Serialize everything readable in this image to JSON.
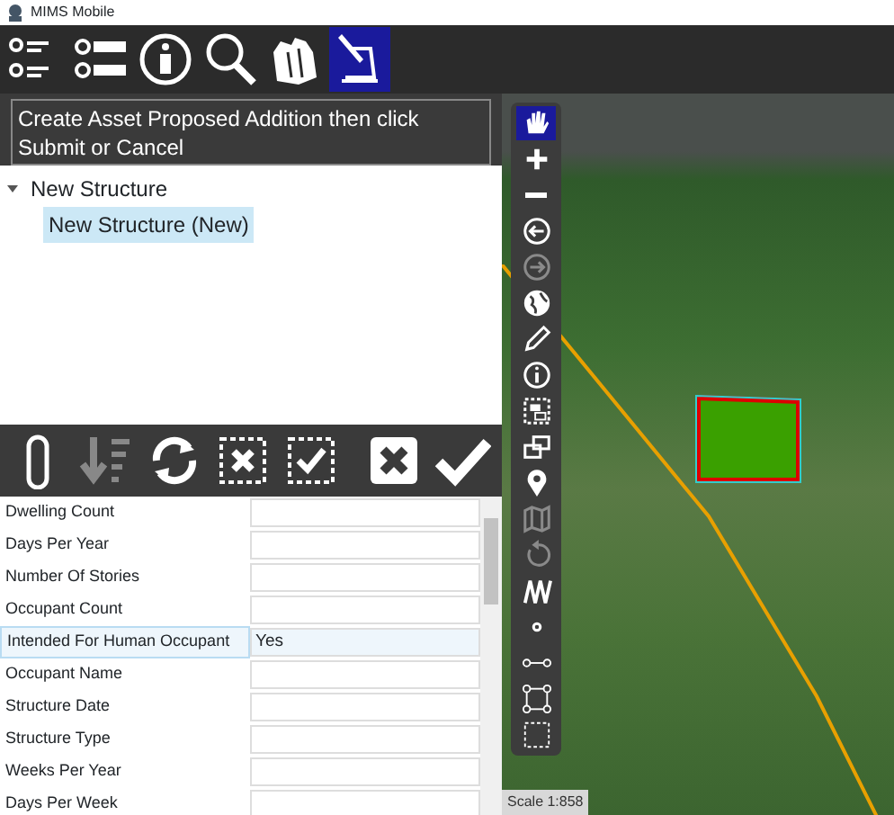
{
  "window": {
    "title": "MIMS Mobile"
  },
  "main_toolbar": [
    {
      "selected": false
    },
    {
      "selected": false
    },
    {
      "selected": false
    },
    {
      "selected": false
    },
    {
      "selected": false
    },
    {
      "selected": true
    }
  ],
  "message": "Create Asset Proposed Addition then click Submit or Cancel",
  "tree": [
    {
      "label": "New Structure",
      "expanded": true,
      "selected": false,
      "children": [
        {
          "label": "New Structure (New)",
          "selected": true
        }
      ]
    }
  ],
  "action_toolbar": [
    {
      "disabled": false
    },
    {
      "disabled": true
    },
    {
      "disabled": false
    },
    {
      "disabled": false
    },
    {
      "disabled": false
    },
    {
      "disabled": false
    },
    {
      "disabled": false
    }
  ],
  "properties": [
    {
      "name": "Dwelling Count",
      "selected": false
    },
    {
      "name": "Days Per Year",
      "selected": false
    },
    {
      "name": "Number Of Stories",
      "selected": false
    },
    {
      "name": "Occupant Count",
      "selected": false
    },
    {
      "name": "Intended For Human Occupant",
      "value": "Yes",
      "selected": true
    },
    {
      "name": "Occupant Name",
      "selected": false
    },
    {
      "name": "Structure Date",
      "selected": false
    },
    {
      "name": "Structure Type",
      "selected": false
    },
    {
      "name": "Weeks Per Year",
      "selected": false
    },
    {
      "name": "Days Per Week",
      "selected": false
    }
  ],
  "map_tools": [
    {
      "selected": true,
      "disabled": false
    },
    {
      "selected": false,
      "disabled": false
    },
    {
      "selected": false,
      "disabled": false
    },
    {
      "selected": false,
      "disabled": false
    },
    {
      "selected": false,
      "disabled": true
    },
    {
      "selected": false,
      "disabled": false
    },
    {
      "selected": false,
      "disabled": false
    },
    {
      "selected": false,
      "disabled": false
    },
    {
      "selected": false,
      "disabled": false
    },
    {
      "selected": false,
      "disabled": false
    },
    {
      "selected": false,
      "disabled": false
    },
    {
      "selected": false,
      "disabled": true
    },
    {
      "selected": false,
      "disabled": true
    },
    {
      "selected": false,
      "disabled": false
    },
    {
      "selected": false,
      "disabled": false
    },
    {
      "selected": false,
      "disabled": false
    },
    {
      "selected": false,
      "disabled": false
    },
    {
      "selected": false,
      "disabled": false
    }
  ],
  "map": {
    "scale": "Scale 1:858"
  }
}
